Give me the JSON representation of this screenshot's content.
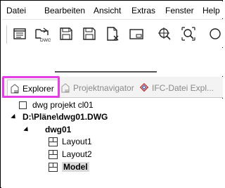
{
  "menubar": {
    "items": [
      "Datei",
      "Bearbeiten",
      "Ansicht",
      "Extras",
      "Fenster",
      "Help"
    ]
  },
  "toolbar": {
    "buttons": [
      {
        "name": "properties-icon"
      },
      {
        "name": "dwg-import-icon",
        "badge": "DWG"
      },
      {
        "name": "save-icon"
      },
      {
        "name": "save-as-icon"
      },
      {
        "name": "close-document-icon"
      },
      {
        "name": "window-icon"
      },
      {
        "name": "zoom-extents-icon"
      },
      {
        "name": "zoom-window-icon"
      },
      {
        "name": "pan-icon"
      }
    ]
  },
  "tabs": [
    {
      "label": "Explorer",
      "active": true
    },
    {
      "label": "Projektnavigator",
      "active": false
    },
    {
      "label": "IFC-Datei Expl...",
      "active": false
    }
  ],
  "tree": {
    "project": "dwg projekt cl01",
    "file": "D:\\Pläne\\dwg01.DWG",
    "drawing": "dwg01",
    "layouts": [
      "Layout1",
      "Layout2",
      "Model"
    ],
    "selected": "Model"
  },
  "colors": {
    "highlight": "#e440e6",
    "accent_red": "#c83232"
  }
}
